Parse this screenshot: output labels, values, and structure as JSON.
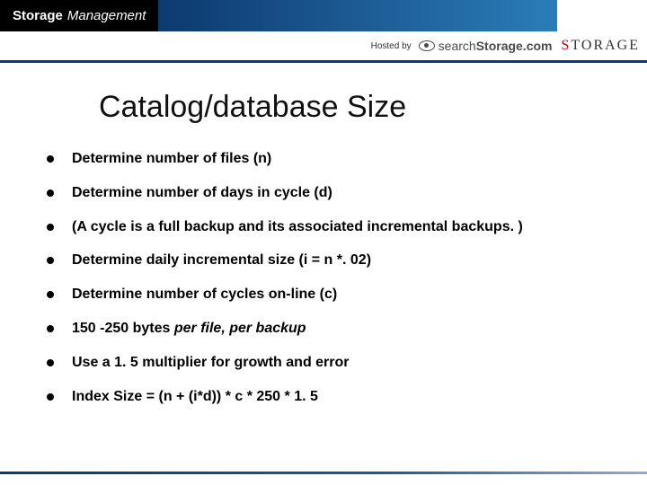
{
  "header": {
    "brand_storage": "Storage",
    "brand_management": "Management",
    "hosted_by": "Hosted by",
    "search_prefix": "search",
    "search_suffix": "Storage.com",
    "storage_logo_s": "S",
    "storage_logo_rest": "TORAGE"
  },
  "slide": {
    "title": "Catalog/database Size",
    "bullets": [
      "Determine number of files (n)",
      "Determine number of days in cycle (d)",
      "(A cycle is a full backup and its associated incremental backups. )",
      "Determine daily incremental size (i = n *. 02)",
      "Determine number of cycles on-line (c)",
      "150 -250 bytes per file, per backup",
      "Use a 1. 5 multiplier for growth and error",
      "Index Size = (n + (i*d)) * c * 250 * 1. 5"
    ]
  }
}
